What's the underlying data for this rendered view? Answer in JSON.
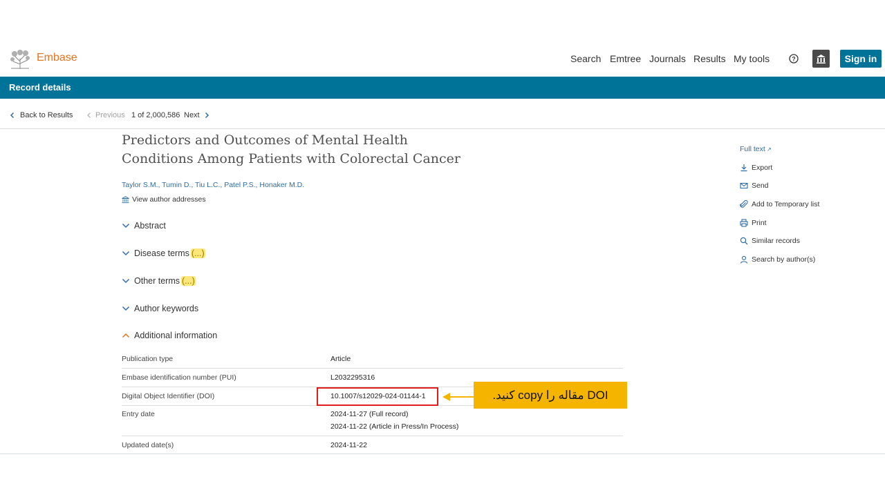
{
  "header": {
    "brand": "Embase",
    "nav": [
      "Search",
      "Emtree",
      "Journals",
      "Results",
      "My tools"
    ],
    "sign_in": "Sign in"
  },
  "bar": {
    "title": "Record details"
  },
  "pager": {
    "back": "Back to Results",
    "previous": "Previous",
    "position": "1 of 2,000,586",
    "next": "Next"
  },
  "record": {
    "title_line1": "Predictors and Outcomes of Mental Health",
    "title_line2": "Conditions Among Patients with Colorectal Cancer",
    "authors": "Taylor S.M., Tumin D., Tiu L.C., Patel P.S., Honaker M.D.",
    "view_addresses": "View author addresses"
  },
  "sections": [
    {
      "label": "Abstract",
      "badge": ""
    },
    {
      "label": "Disease terms",
      "badge": "(...)"
    },
    {
      "label": "Other terms",
      "badge": "(...)"
    },
    {
      "label": "Author keywords",
      "badge": ""
    },
    {
      "label": "Additional information",
      "badge": ""
    }
  ],
  "info": [
    {
      "label": "Publication type",
      "values": [
        "Article"
      ]
    },
    {
      "label": "Embase identification number (PUI)",
      "values": [
        "L2032295316"
      ]
    },
    {
      "label": "Digital Object Identifier (DOI)",
      "values": [
        "10.1007/s12029-024-01144-1"
      ]
    },
    {
      "label": "Entry date",
      "values": [
        "2024-11-27 (Full record)",
        "2024-11-22 (Article in Press/In Process)"
      ]
    },
    {
      "label": "Updated date(s)",
      "values": [
        "2024-11-22"
      ]
    }
  ],
  "callout": {
    "text": "DOI مقاله را copy کنید."
  },
  "side": {
    "full_text": "Full text",
    "actions": [
      "Export",
      "Send",
      "Add to Temporary list",
      "Print",
      "Similar records",
      "Search by author(s)"
    ]
  },
  "colors": {
    "brand_orange": "#e9711c",
    "primary_blue": "#007398",
    "callout_yellow": "#f4b400",
    "highlight_red": "#e11c1c"
  }
}
